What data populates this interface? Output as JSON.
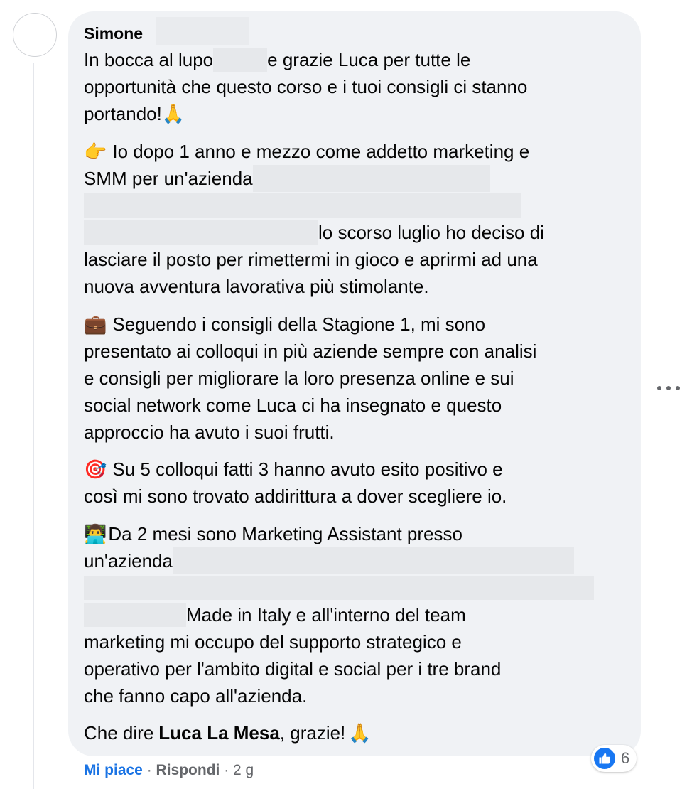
{
  "comment": {
    "author": "Simone",
    "paragraphs": [
      {
        "lines": [
          {
            "before": "In bocca al lupo ",
            "redact_w": 70,
            "after": " e grazie Luca per tutte le"
          },
          {
            "text": "opportunità che questo corso e i tuoi consigli ci stanno"
          },
          {
            "text": "portando! ",
            "emoji": "🙏"
          }
        ]
      },
      {
        "lines": [
          {
            "emoji": "👉",
            "text": "Io dopo 1 anno e mezzo come addetto marketing e"
          },
          {
            "text": "SMM per un'azienda ",
            "redact_after_w": 330
          },
          {
            "redact_before_w": 330
          },
          {
            "redact_before_w": 330,
            "after": " lo scorso luglio ho deciso di"
          },
          {
            "text": "lasciare il posto per rimettermi in gioco e aprirmi ad una"
          },
          {
            "text": "nuova avventura lavorativa più stimolante."
          }
        ]
      },
      {
        "lines": [
          {
            "emoji": "💼",
            "text": "Seguendo i consigli della Stagione 1, mi sono"
          },
          {
            "text": "presentato ai colloqui in più aziende sempre con analisi"
          },
          {
            "text": "e consigli per migliorare la loro presenza online e sui"
          },
          {
            "text": "social network come Luca ci ha insegnato e questo"
          },
          {
            "text": "approccio ha avuto i suoi frutti."
          }
        ]
      },
      {
        "lines": [
          {
            "emoji": "🎯",
            "text": "Su 5 colloqui fatti 3 hanno avuto esito positivo e"
          },
          {
            "text": "così mi sono trovato addirittura a dover scegliere io."
          }
        ]
      },
      {
        "lines": [
          {
            "emoji": "👨‍💻",
            "text": "Da 2 mesi sono Marketing Assistant presso"
          },
          {
            "text": "un'azienda ",
            "redact_after_w": 560
          },
          {
            "redact_before_w": 720
          },
          {
            "redact_before_w": 140,
            "after": " Made in Italy e all'interno del team"
          },
          {
            "text": "marketing mi occupo del supporto strategico e"
          },
          {
            "text": "operativo per l'ambito digital e social per i tre brand"
          },
          {
            "text": "che fanno capo all'azienda."
          }
        ]
      },
      {
        "lines": [
          {
            "text": "Che dire ",
            "bold": "Luca La Mesa",
            "after": ", grazie! ",
            "emoji_end": "🙏"
          }
        ]
      }
    ],
    "actions": {
      "like": "Mi piace",
      "sep1": " · ",
      "reply": "Rispondi",
      "sep2": " · ",
      "time": "2 g"
    },
    "reactions": {
      "count": "6",
      "icon": "thumbs-up-icon",
      "color": "#1877f2"
    },
    "more_icon": "more-horizontal-icon"
  }
}
